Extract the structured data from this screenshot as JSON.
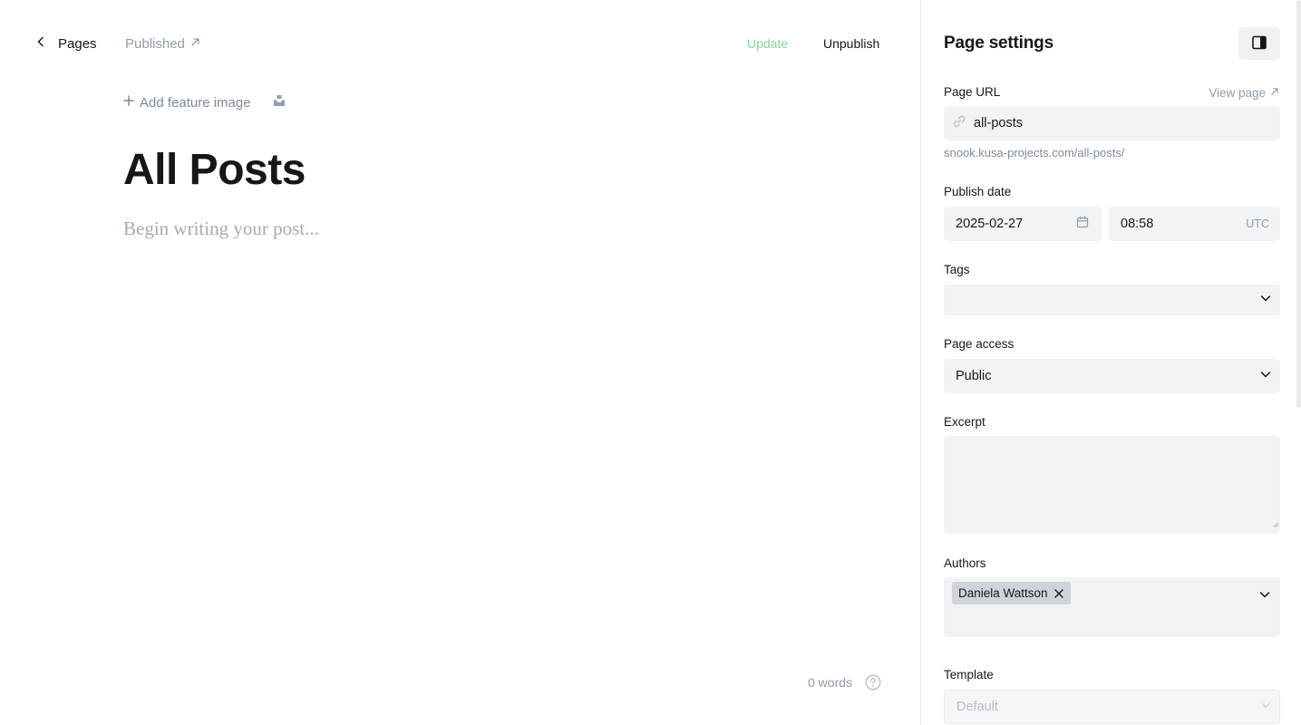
{
  "header": {
    "back_label": "Pages",
    "status_label": "Published",
    "update_label": "Update",
    "unpublish_label": "Unpublish"
  },
  "editor": {
    "add_feature_image_label": "Add feature image",
    "title": "All Posts",
    "body_placeholder": "Begin writing your post...",
    "word_count": "0 words"
  },
  "settings": {
    "title": "Page settings",
    "page_url": {
      "label": "Page URL",
      "view_page_label": "View page",
      "value": "all-posts",
      "hint": "snook.kusa-projects.com/all-posts/"
    },
    "publish_date": {
      "label": "Publish date",
      "date": "2025-02-27",
      "time": "08:58",
      "timezone": "UTC"
    },
    "tags": {
      "label": "Tags",
      "value": ""
    },
    "page_access": {
      "label": "Page access",
      "value": "Public"
    },
    "excerpt": {
      "label": "Excerpt",
      "value": ""
    },
    "authors": {
      "label": "Authors",
      "items": [
        "Daniela Wattson"
      ]
    },
    "template": {
      "label": "Template",
      "value": "Default"
    }
  },
  "colors": {
    "update_green": "#86d493",
    "muted_text": "#8e9cac",
    "field_bg": "#f1f3f4",
    "chip_bg": "#ced4d9"
  },
  "icons": {
    "back": "chevron-left-icon",
    "external": "arrow-up-right-icon",
    "plus": "plus-icon",
    "unsplash": "unsplash-icon",
    "link": "link-icon",
    "calendar": "calendar-icon",
    "chevron": "chevron-down-icon",
    "close": "close-icon",
    "help": "question-circle-icon",
    "sidebar": "sidebar-toggle-icon"
  }
}
